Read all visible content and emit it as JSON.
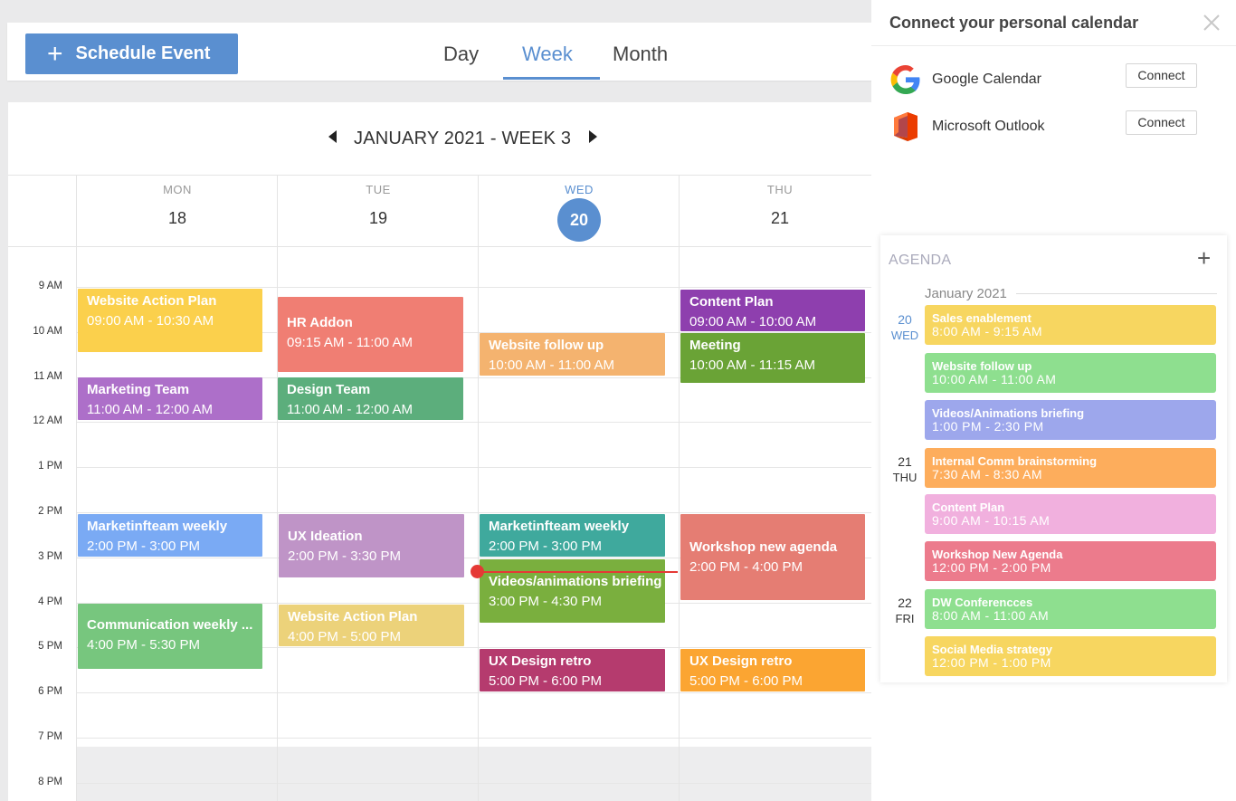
{
  "toolbar": {
    "schedule_label": "Schedule Event",
    "tabs": [
      {
        "label": "Day",
        "active": false
      },
      {
        "label": "Week",
        "active": true
      },
      {
        "label": "Month",
        "active": false
      }
    ]
  },
  "calendar": {
    "week_title": "JANUARY 2021 - WEEK 3",
    "days": [
      {
        "name": "MON",
        "num": "18",
        "today": false
      },
      {
        "name": "TUE",
        "num": "19",
        "today": false
      },
      {
        "name": "WED",
        "num": "20",
        "today": true
      },
      {
        "name": "THU",
        "num": "21",
        "today": false
      }
    ],
    "hours": [
      "9 AM",
      "10 AM",
      "11 AM",
      "12 AM",
      "1 PM",
      "2 PM",
      "3 PM",
      "4 PM",
      "5 PM",
      "6 PM",
      "7 PM",
      "8 PM"
    ],
    "events": [
      {
        "day": "MON",
        "title": "Website Action Plan",
        "time": "09:00 AM - 10:30 AM",
        "color": "#fbd04c"
      },
      {
        "day": "MON",
        "title": "Marketing Team",
        "time": "11:00 AM - 12:00 AM",
        "color": "#ad6fc9"
      },
      {
        "day": "MON",
        "title": "Marketinfteam weekly",
        "time": "2:00 PM - 3:00 PM",
        "color": "#7aaaf4"
      },
      {
        "day": "MON",
        "title": "Communication weekly ...",
        "time": "4:00 PM - 5:30 PM",
        "color": "#77c67e"
      },
      {
        "day": "TUE",
        "title": "HR Addon",
        "time": "09:15 AM - 11:00 AM",
        "color": "#f07e73"
      },
      {
        "day": "TUE",
        "title": "Design Team",
        "time": "11:00 AM - 12:00 AM",
        "color": "#5cae7c"
      },
      {
        "day": "TUE",
        "title": "UX Ideation",
        "time": "2:00 PM - 3:30 PM",
        "color": "#bf94c7"
      },
      {
        "day": "TUE",
        "title": "Website Action Plan",
        "time": "4:00 PM - 5:00 PM",
        "color": "#ecd27a"
      },
      {
        "day": "WED",
        "title": "Website follow up",
        "time": "10:00 AM - 11:00 AM",
        "color": "#f4b36f"
      },
      {
        "day": "WED",
        "title": "Marketinfteam weekly",
        "time": "2:00 PM - 3:00 PM",
        "color": "#3fa99d"
      },
      {
        "day": "WED",
        "title": "Videos/animations briefing",
        "time": "3:00 PM - 4:30 PM",
        "color": "#7aaf3e"
      },
      {
        "day": "WED",
        "title": "UX  Design retro",
        "time": "5:00 PM - 6:00 PM",
        "color": "#b53b6e"
      },
      {
        "day": "THU",
        "title": "Content Plan",
        "time": "09:00 AM - 10:00 AM",
        "color": "#8e3fae"
      },
      {
        "day": "THU",
        "title": "Meeting",
        "time": "10:00 AM - 11:15 AM",
        "color": "#6aa336"
      },
      {
        "day": "THU",
        "title": "Workshop new agenda",
        "time": "2:00 PM - 4:00 PM",
        "color": "#e57d73"
      },
      {
        "day": "THU",
        "title": "UX  Design retro",
        "time": "5:00 PM - 6:00 PM",
        "color": "#fba532"
      }
    ]
  },
  "side": {
    "title": "Connect your personal calendar",
    "calendars": [
      {
        "name": "Google Calendar",
        "button": "Connect",
        "icon": "google-icon"
      },
      {
        "name": "Microsoft Outlook",
        "button": "Connect",
        "icon": "outlook-icon"
      }
    ],
    "agenda": {
      "title": "AGENDA",
      "add_label": "+",
      "month": "January 2021",
      "days": [
        {
          "num": "20",
          "dow": "WED",
          "today": true
        },
        {
          "num": "21",
          "dow": "THU",
          "today": false
        },
        {
          "num": "22",
          "dow": "FRI",
          "today": false
        }
      ],
      "events": [
        {
          "title": "Sales enablement",
          "time": "8:00 AM - 9:15 AM",
          "color": "#f7d660"
        },
        {
          "title": "Website follow up",
          "time": "10:00 AM - 11:00 AM",
          "color": "#8edf8f"
        },
        {
          "title": "Videos/Animations briefing",
          "time": "1:00 PM - 2:30 PM",
          "color": "#9da7ec"
        },
        {
          "title": "Internal Comm brainstorming",
          "time": "7:30 AM - 8:30 AM",
          "color": "#fdad5c"
        },
        {
          "title": "Content Plan",
          "time": "9:00 AM - 10:15 AM",
          "color": "#f1b0de"
        },
        {
          "title": "Workshop New Agenda",
          "time": "12:00 PM - 2:00 PM",
          "color": "#ec7b8c"
        },
        {
          "title": "DW Conferencces",
          "time": "8:00 AM - 11:00 AM",
          "color": "#8edf8f"
        },
        {
          "title": "Social Media strategy",
          "time": "12:00 PM - 1:00 PM",
          "color": "#f7d660"
        }
      ]
    }
  }
}
